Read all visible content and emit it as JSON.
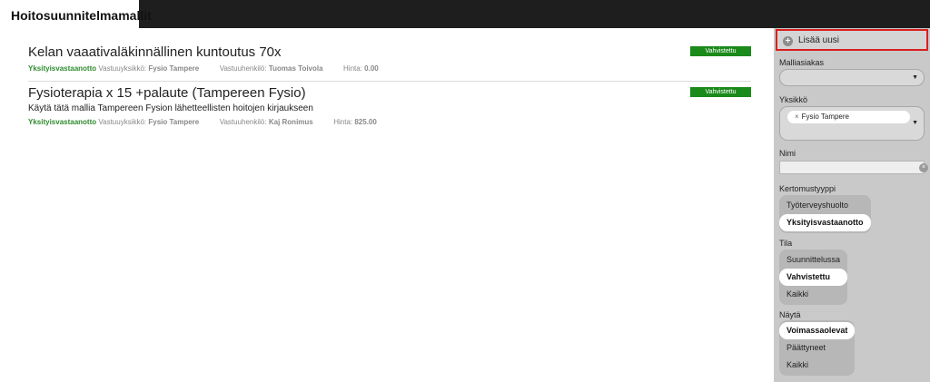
{
  "header": {
    "title": "Hoitosuunnitelmamallit"
  },
  "items": [
    {
      "title": "Kelan vaaativaläkinnällinen kuntoutus 70x",
      "description": "",
      "type": "Yksityisvastaanotto",
      "unit_label": "Vastuuyksikkö:",
      "unit": "Fysio Tampere",
      "person_label": "Vastuuhenkilö:",
      "person": "Tuomas Toivola",
      "price_label": "Hinta:",
      "price": "0.00",
      "status": "Vahvistettu"
    },
    {
      "title": "Fysioterapia x 15 +palaute (Tampereen Fysio)",
      "description": "Käytä tätä mallia Tampereen Fysion lähetteellisten hoitojen kirjaukseen",
      "type": "Yksityisvastaanotto",
      "unit_label": "Vastuuyksikkö:",
      "unit": "Fysio Tampere",
      "person_label": "Vastuuhenkilö:",
      "person": "Kaj Ronimus",
      "price_label": "Hinta:",
      "price": "825.00",
      "status": "Vahvistettu"
    }
  ],
  "sidebar": {
    "add_new": "Lisää uusi",
    "customer_label": "Malliasiakas",
    "customer_value": "",
    "unit_label": "Yksikkö",
    "unit_chip": "Fysio Tampere",
    "name_label": "Nimi",
    "name_value": "",
    "type_label": "Kertomustyyppi",
    "type_options": [
      "Työterveyshuolto",
      "Yksityisvastaanotto"
    ],
    "type_selected": 1,
    "state_label": "Tila",
    "state_options": [
      "Suunnittelussa",
      "Vahvistettu",
      "Kaikki"
    ],
    "state_selected": 1,
    "show_label": "Näytä",
    "show_options": [
      "Voimassaolevat",
      "Päättyneet",
      "Kaikki"
    ],
    "show_selected": 0
  },
  "colors": {
    "status_green": "#1a8a1a",
    "type_green": "#2e8b2e",
    "highlight_red": "#d91f1f"
  }
}
